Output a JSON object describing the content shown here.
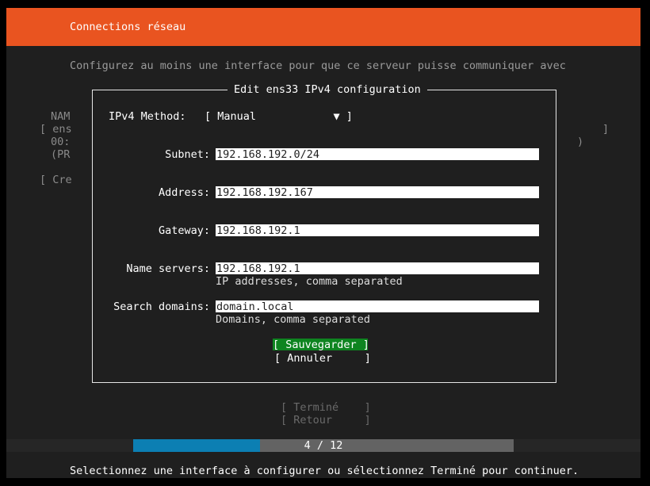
{
  "header": {
    "title": "Connections réseau"
  },
  "intro": "Configurez au moins une interface pour que ce serveur puisse communiquer avec",
  "background": {
    "lines": [
      "NAM",
      "[ ens",
      "00:",
      "(PR"
    ],
    "right_bracket": "]",
    "right_paren": ")",
    "create_button": "[ Cre"
  },
  "dialog": {
    "title": "Edit ens33 IPv4 configuration",
    "method_label": "IPv4 Method:",
    "method_value": "[ Manual            ▼ ]",
    "subnet_label": "Subnet:",
    "subnet_value": "192.168.192.0/24",
    "address_label": "Address:",
    "address_value": "192.168.192.167",
    "gateway_label": "Gateway:",
    "gateway_value": "192.168.192.1",
    "nameservers_label": "Name servers:",
    "nameservers_value": "192.168.192.1",
    "nameservers_help": "IP addresses, comma separated",
    "searchdomains_label": "Search domains:",
    "searchdomains_value": "domain.local",
    "searchdomains_help": "Domains, comma separated",
    "save_button": "[ Sauvegarder ]",
    "cancel_button": "[ Annuler     ]"
  },
  "nav": {
    "done_button": "[ Terminé    ]",
    "back_button": "[ Retour     ]"
  },
  "progress": {
    "text": "4 / 12",
    "current": 4,
    "total": 12
  },
  "footer": "Selectionnez une interface à configurer ou sélectionnez Terminé pour continuer.",
  "colors": {
    "header": "#e95420",
    "background": "#1f1f1f",
    "save_button": "#0e8420",
    "progress_fill": "#0c7fb3",
    "progress_track": "#636363"
  }
}
